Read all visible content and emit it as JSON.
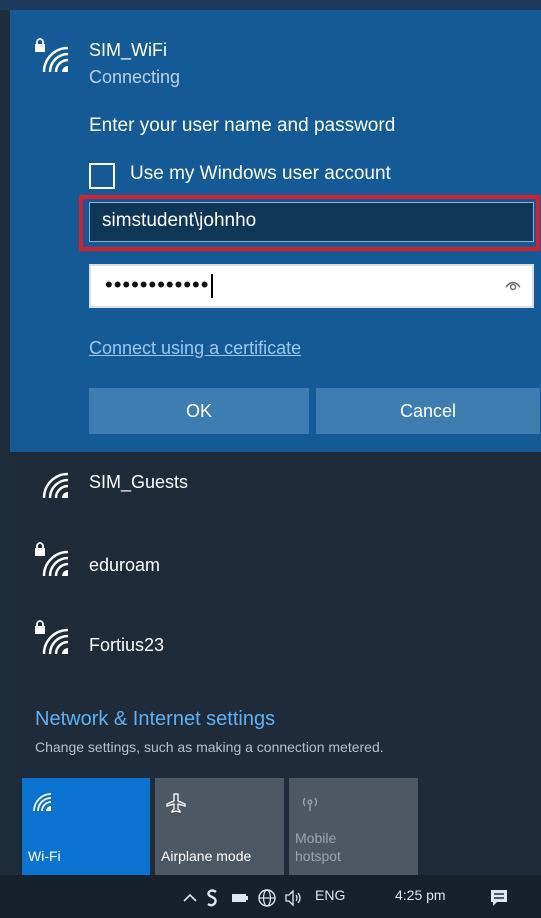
{
  "active_network": {
    "name": "SIM_WiFi",
    "status": "Connecting",
    "prompt": "Enter your user name and password",
    "checkbox_label": "Use my Windows user account",
    "username_value": "simstudent\\johnho",
    "password_mask": "••••••••••••",
    "cert_link": "Connect using a certificate",
    "ok_label": "OK",
    "cancel_label": "Cancel"
  },
  "networks": [
    {
      "name": "SIM_Guests",
      "secured": false
    },
    {
      "name": "eduroam",
      "secured": true
    },
    {
      "name": "Fortius23",
      "secured": true
    }
  ],
  "settings": {
    "title": "Network & Internet settings",
    "subtitle": "Change settings, such as making a connection metered."
  },
  "quick_actions": [
    {
      "label": "Wi-Fi",
      "icon": "wifi-icon",
      "state": "on"
    },
    {
      "label": "Airplane mode",
      "icon": "airplane-icon",
      "state": "off"
    },
    {
      "label": "Mobile\nhotspot",
      "icon": "hotspot-icon",
      "state": "disabled"
    }
  ],
  "taskbar": {
    "lang": "ENG",
    "time": "4:25 pm"
  },
  "colors": {
    "panel_blue": "#135a96",
    "panel_dark": "#1f2b38",
    "accent": "#0b72cf",
    "highlight_red": "#d8202a"
  }
}
